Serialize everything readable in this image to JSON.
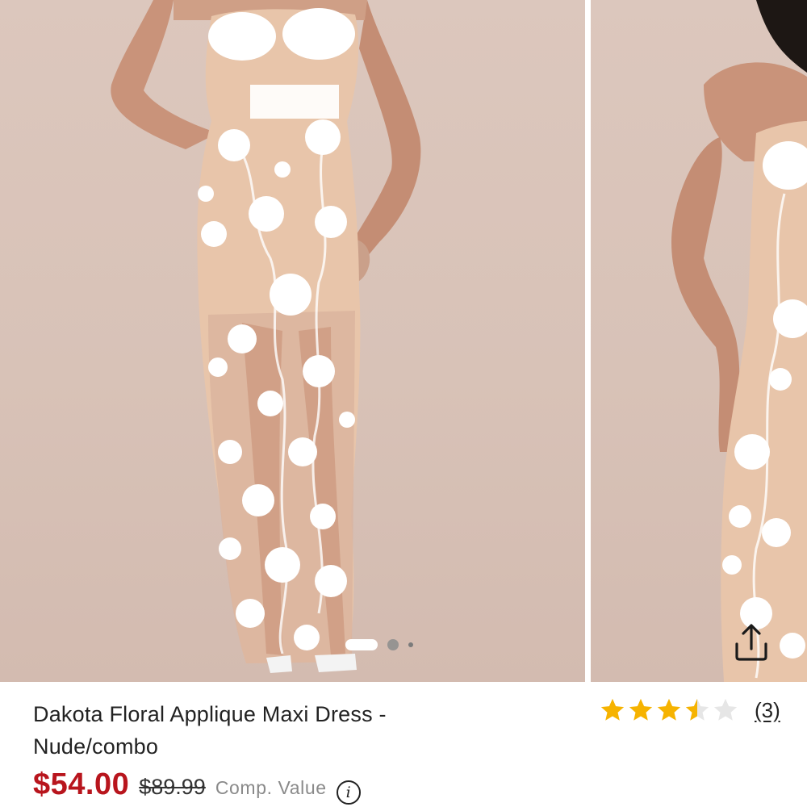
{
  "gallery": {
    "images": [
      {
        "name": "product-photo-front"
      },
      {
        "name": "product-photo-side"
      }
    ],
    "pagination": {
      "total": 3,
      "active_index": 0
    }
  },
  "product": {
    "title_line1": "Dakota Floral Applique Maxi Dress -",
    "title_line2": "Nude/combo"
  },
  "rating": {
    "value": 3.5,
    "max": 5,
    "count_label": "(3)",
    "star_color": "#f6b300",
    "empty_star_color": "#e6e6e6"
  },
  "pricing": {
    "current": "$54.00",
    "original": "$89.99",
    "comp_label": "Comp. Value",
    "info_icon_glyph": "i",
    "current_color": "#b8151d"
  },
  "icons": {
    "share": "share-icon",
    "info": "info-icon"
  }
}
